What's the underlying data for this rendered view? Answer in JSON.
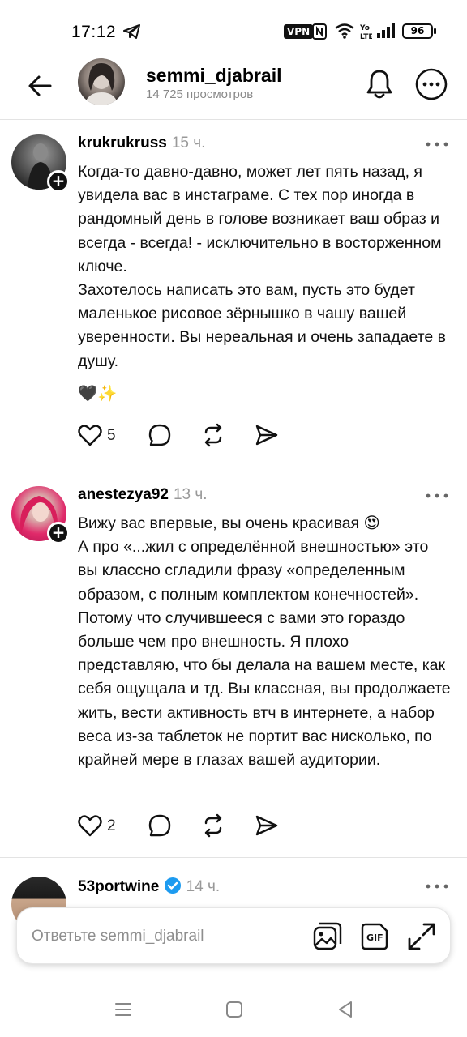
{
  "status_bar": {
    "time": "17:12",
    "vpn": "VPN",
    "battery": "96",
    "icons": [
      "telegram-icon",
      "nfc-icon",
      "wifi-icon",
      "volte-icon",
      "signal-icon",
      "battery-icon"
    ]
  },
  "header": {
    "username": "semmi_djabrail",
    "views": "14 725 просмотров"
  },
  "comments": [
    {
      "username": "krukrukruss",
      "time": "15 ч.",
      "text": "Когда-то давно-давно, может лет пять назад, я увидела вас в инстаграме. С тех пор иногда в рандомный день в голове возникает ваш образ и всегда - всегда! - исключительно в восторженном ключе.\nЗахотелось написать это вам, пусть это будет маленькое рисовое зёрнышко в чашу вашей уверенности. Вы нереальная и очень западаете в душу.",
      "emoji": "🖤✨",
      "likes": "5"
    },
    {
      "username": "anestezya92",
      "time": "13 ч.",
      "text": "Вижу вас впервые, вы очень красивая 😍\nА про «...жил с определённой внешностью» это вы классно сгладили фразу «определенным образом, с полным комплектом конечностей». Потому что случившееся с вами это гораздо больше чем про внешность. Я плохо представляю, что бы делала на вашем месте, как себя ощущала и тд. Вы классная, вы продолжаете  жить, вести активность втч в интернете, а набор веса из-за таблеток не портит вас нисколько, по крайней мере в глазах вашей аудитории.",
      "likes": "2"
    },
    {
      "username": "53portwine",
      "time": "14 ч.",
      "verified": true
    }
  ],
  "reply": {
    "placeholder": "Ответьте semmi_djabrail"
  },
  "colors": {
    "verified": "#1d9bf0",
    "muted": "#8e8e8e"
  }
}
